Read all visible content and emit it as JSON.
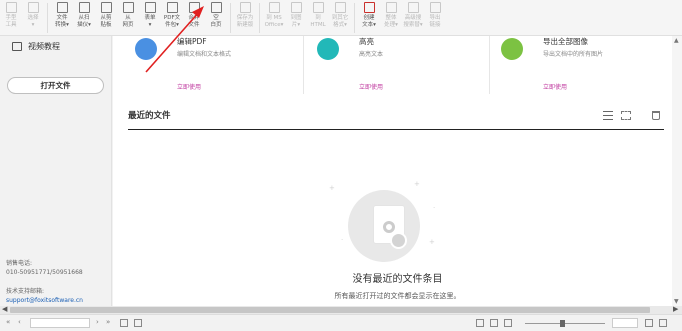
{
  "toolbar": {
    "buttons": [
      {
        "l1": "手型",
        "l2": "工具",
        "disabled": true
      },
      {
        "l1": "选择",
        "l2": "▾",
        "disabled": true
      },
      {
        "l1": "文件",
        "l2": "转换▾",
        "disabled": false
      },
      {
        "l1": "从扫",
        "l2": "描仪▾",
        "disabled": false
      },
      {
        "l1": "从剪",
        "l2": "贴板",
        "disabled": false
      },
      {
        "l1": "从",
        "l2": "网页",
        "disabled": false
      },
      {
        "l1": "表单",
        "l2": "▾",
        "disabled": false
      },
      {
        "l1": "PDF文",
        "l2": "件包▾",
        "disabled": false
      },
      {
        "l1": "合并",
        "l2": "文件",
        "disabled": false
      },
      {
        "l1": "空",
        "l2": "白页",
        "disabled": false
      },
      {
        "l1": "保存为",
        "l2": "新建版",
        "disabled": true
      },
      {
        "l1": "到 MS",
        "l2": "Office▾",
        "disabled": true
      },
      {
        "l1": "到图",
        "l2": "片▾",
        "disabled": true
      },
      {
        "l1": "到",
        "l2": "HTML",
        "disabled": true
      },
      {
        "l1": "到其它",
        "l2": "格式▾",
        "disabled": true
      },
      {
        "l1": "创建",
        "l2": "文本▾",
        "disabled": false
      },
      {
        "l1": "整体",
        "l2": "处理▾",
        "disabled": true
      },
      {
        "l1": "高级搜",
        "l2": "搜索替▾",
        "disabled": true
      },
      {
        "l1": "导出",
        "l2": "链接",
        "disabled": true
      }
    ]
  },
  "left": {
    "video_tutorial": "视频教程",
    "open_file": "打开文件",
    "sales_label": "销售电话:",
    "sales_phone": "010-50951771/50951668",
    "support_label": "技术支持邮箱:",
    "support_email": "support@foxitsoftware.cn"
  },
  "cards": [
    {
      "title": "编辑PDF",
      "desc": "编辑文档和文本格式",
      "link": "立即使用",
      "color": "#4a90e2"
    },
    {
      "title": "高亮",
      "desc": "高亮文本",
      "link": "立即使用",
      "color": "#22b8b8"
    },
    {
      "title": "导出全部图像",
      "desc": "导出文档中的所有图片",
      "link": "立即使用",
      "color": "#7cc242"
    }
  ],
  "recent": {
    "title": "最近的文件",
    "empty_title": "没有最近的文件条目",
    "empty_desc": "所有最近打开过的文件都会显示在这里。"
  },
  "colors": {
    "annotation_arrow": "#e02020"
  }
}
